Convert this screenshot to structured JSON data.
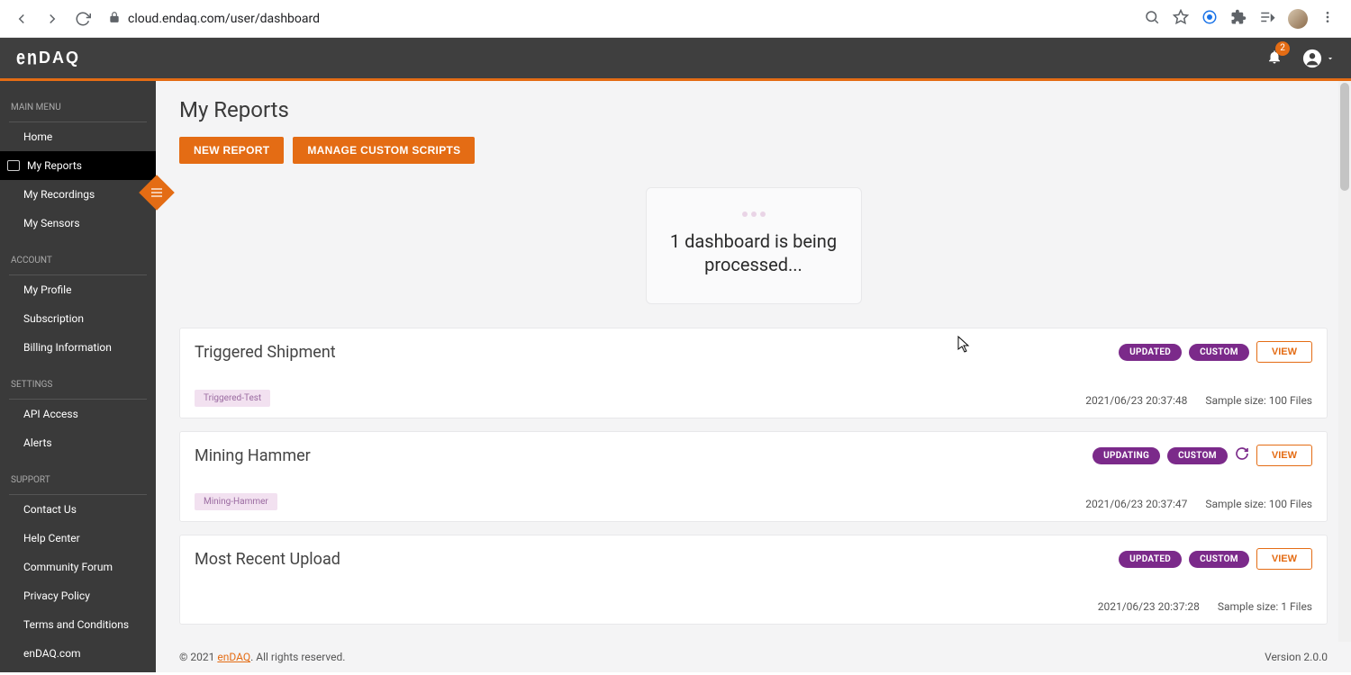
{
  "browser": {
    "url": "cloud.endaq.com/user/dashboard"
  },
  "header": {
    "logo": "enDAQ",
    "notifications": "2"
  },
  "sidebar": {
    "sections": [
      {
        "label": "MAIN MENU",
        "items": [
          "Home",
          "My Reports",
          "My Recordings",
          "My Sensors"
        ]
      },
      {
        "label": "ACCOUNT",
        "items": [
          "My Profile",
          "Subscription",
          "Billing Information"
        ]
      },
      {
        "label": "SETTINGS",
        "items": [
          "API Access",
          "Alerts"
        ]
      },
      {
        "label": "SUPPORT",
        "items": [
          "Contact Us",
          "Help Center",
          "Community Forum",
          "Privacy Policy",
          "Terms and Conditions",
          "enDAQ.com"
        ]
      }
    ]
  },
  "page": {
    "title": "My Reports",
    "buttons": {
      "new_report": "NEW REPORT",
      "manage_scripts": "MANAGE CUSTOM SCRIPTS"
    },
    "processing": "1 dashboard is being processed..."
  },
  "reports": [
    {
      "title": "Triggered Shipment",
      "tag": "Triggered-Test",
      "badges": [
        "UPDATED",
        "CUSTOM"
      ],
      "refresh": false,
      "timestamp": "2021/06/23 20:37:48",
      "sample": "Sample size: 100 Files",
      "view": "VIEW"
    },
    {
      "title": "Mining Hammer",
      "tag": "Mining-Hammer",
      "badges": [
        "UPDATING",
        "CUSTOM"
      ],
      "refresh": true,
      "timestamp": "2021/06/23 20:37:47",
      "sample": "Sample size: 100 Files",
      "view": "VIEW"
    },
    {
      "title": "Most Recent Upload",
      "tag": "",
      "badges": [
        "UPDATED",
        "CUSTOM"
      ],
      "refresh": false,
      "timestamp": "2021/06/23 20:37:28",
      "sample": "Sample size: 1 Files",
      "view": "VIEW"
    }
  ],
  "footer": {
    "copyright_pre": "© 2021 ",
    "copyright_link": "enDAQ",
    "copyright_post": ". All rights reserved.",
    "version": "Version 2.0.0"
  }
}
